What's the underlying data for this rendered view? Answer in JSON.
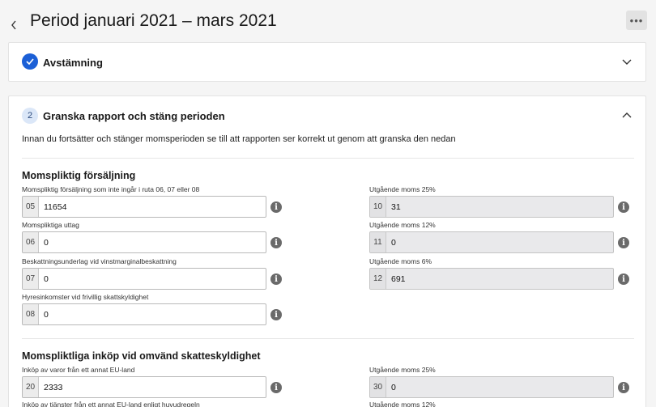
{
  "header": {
    "title": "Period januari 2021 – mars 2021",
    "more_label": "•••"
  },
  "steps": {
    "reconciliation": {
      "title": "Avstämning"
    },
    "review": {
      "number": "2",
      "title": "Granska rapport och stäng perioden",
      "intro": "Innan du fortsätter och stänger momsperioden se till att rapporten ser korrekt ut genom att granska den nedan"
    }
  },
  "sections": {
    "sales": {
      "title": "Momspliktig försäljning",
      "fields": [
        {
          "code": "05",
          "label": "Momspliktig försäljning som inte ingår i ruta 06, 07 eller 08",
          "value": "11654"
        },
        {
          "code": "06",
          "label": "Momspliktiga uttag",
          "value": "0"
        },
        {
          "code": "07",
          "label": "Beskattningsunderlag vid vinstmarginalbeskattning",
          "value": "0"
        },
        {
          "code": "08",
          "label": "Hyresinkomster vid frivillig skattskyldighet",
          "value": "0"
        }
      ],
      "output_vat": [
        {
          "code": "10",
          "label": "Utgående moms 25%",
          "value": "31"
        },
        {
          "code": "11",
          "label": "Utgående moms 12%",
          "value": "0"
        },
        {
          "code": "12",
          "label": "Utgående moms 6%",
          "value": "691"
        }
      ]
    },
    "reverse_charge": {
      "title": "Momspliktliga inköp vid omvänd skatteskyldighet",
      "fields": [
        {
          "code": "20",
          "label": "Inköp av varor från ett annat EU-land",
          "value": "2333"
        },
        {
          "label": "Inköp av tjänster från ett annat EU-land enligt huvudregeln"
        }
      ],
      "output_vat": [
        {
          "code": "30",
          "label": "Utgående moms 25%",
          "value": "0"
        },
        {
          "label": "Utgående moms 12%"
        }
      ]
    }
  },
  "colors": {
    "accent": "#1b5fd6",
    "info_icon": "#6a6a6a"
  }
}
